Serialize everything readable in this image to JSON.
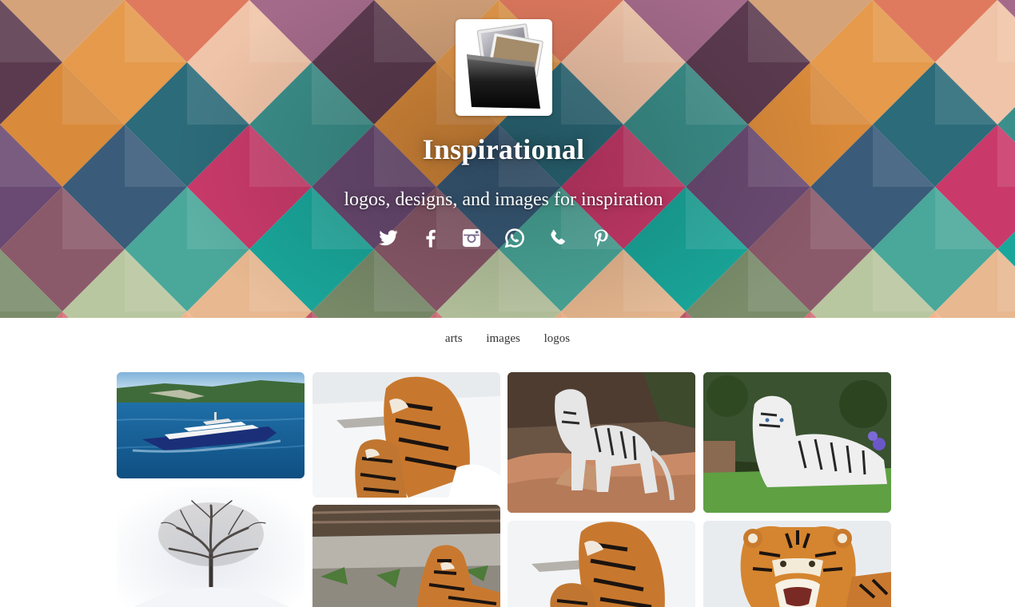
{
  "header": {
    "title": "Inspirational",
    "tagline": "logos, designs, and images for inspiration",
    "logo_icon": "photo-folder-icon",
    "social": [
      {
        "name": "twitter",
        "icon": "twitter-icon"
      },
      {
        "name": "facebook",
        "icon": "facebook-icon"
      },
      {
        "name": "instagram",
        "icon": "instagram-icon"
      },
      {
        "name": "whatsapp",
        "icon": "whatsapp-icon"
      },
      {
        "name": "phone",
        "icon": "phone-icon"
      },
      {
        "name": "pinterest",
        "icon": "pinterest-icon"
      }
    ]
  },
  "filters": [
    {
      "label": "arts"
    },
    {
      "label": "images"
    },
    {
      "label": "logos"
    }
  ],
  "gallery": [
    {
      "subject": "yacht on blue water"
    },
    {
      "subject": "tigers in snow"
    },
    {
      "subject": "white tiger on rocks"
    },
    {
      "subject": "white tiger lying on grass"
    },
    {
      "subject": "bare tree in snow"
    },
    {
      "subject": "tiger lying near wall"
    },
    {
      "subject": "tigers in snow"
    },
    {
      "subject": "roaring tiger in snow"
    }
  ],
  "colors": {
    "text": "#333333",
    "hero_text": "#ffffff",
    "teal": "#1aa79b",
    "pink": "#c93a6a",
    "orange": "#e59a4c"
  }
}
